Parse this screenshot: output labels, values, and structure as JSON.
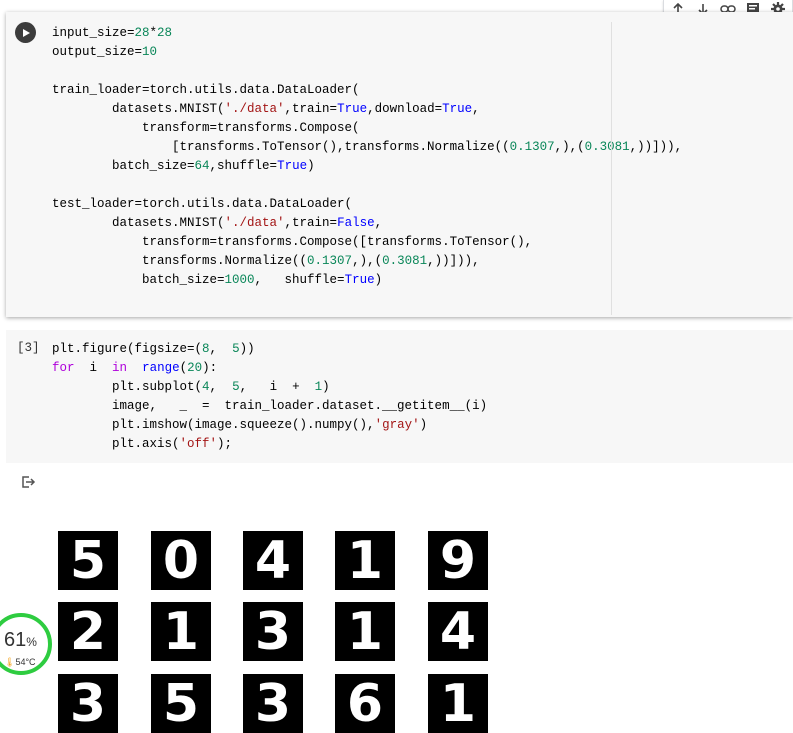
{
  "toolbar": {
    "icons": [
      "arrow-up-icon",
      "arrow-down-icon",
      "link-icon",
      "comment-icon",
      "settings-icon"
    ]
  },
  "cell1": {
    "lines": [
      [
        [
          "input_size=",
          ""
        ],
        [
          "28",
          "n"
        ],
        [
          "*",
          ""
        ],
        [
          "28",
          "n"
        ]
      ],
      [
        [
          "output_size=",
          ""
        ],
        [
          "10",
          "n"
        ]
      ],
      [],
      [
        [
          "train_loader=torch.utils.data.DataLoader(",
          ""
        ]
      ],
      [
        [
          "        datasets.MNIST(",
          ""
        ],
        [
          "'./data'",
          "s"
        ],
        [
          ",train=",
          ""
        ],
        [
          "True",
          "k"
        ],
        [
          ",download=",
          ""
        ],
        [
          "True",
          "k"
        ],
        [
          ",",
          ""
        ]
      ],
      [
        [
          "            transform=transforms.Compose(",
          ""
        ]
      ],
      [
        [
          "                [transforms.ToTensor(),transforms.Normalize((",
          ""
        ],
        [
          "0.1307",
          "n"
        ],
        [
          ",),(",
          ""
        ],
        [
          "0.3081",
          "n"
        ],
        [
          ",))])),",
          ""
        ]
      ],
      [
        [
          "        batch_size=",
          ""
        ],
        [
          "64",
          "n"
        ],
        [
          ",shuffle=",
          ""
        ],
        [
          "True",
          "k"
        ],
        [
          ")",
          ""
        ]
      ],
      [],
      [
        [
          "test_loader=torch.utils.data.DataLoader(",
          ""
        ]
      ],
      [
        [
          "        datasets.MNIST(",
          ""
        ],
        [
          "'./data'",
          "s"
        ],
        [
          ",train=",
          ""
        ],
        [
          "False",
          "k"
        ],
        [
          ",",
          ""
        ]
      ],
      [
        [
          "            transform=transforms.Compose([transforms.ToTensor(),",
          ""
        ]
      ],
      [
        [
          "            transforms.Normalize((",
          ""
        ],
        [
          "0.1307",
          "n"
        ],
        [
          ",),(",
          ""
        ],
        [
          "0.3081",
          "n"
        ],
        [
          ",))])),",
          ""
        ]
      ],
      [
        [
          "            batch_size=",
          ""
        ],
        [
          "1000",
          "n"
        ],
        [
          ",   shuffle=",
          ""
        ],
        [
          "True",
          "k"
        ],
        [
          ")",
          ""
        ]
      ]
    ]
  },
  "cell2": {
    "exec_count": "[3]",
    "lines": [
      [
        [
          "plt.figure(figsize=(",
          ""
        ],
        [
          "8",
          "n"
        ],
        [
          ",  ",
          ""
        ],
        [
          "5",
          "n"
        ],
        [
          "))",
          ""
        ]
      ],
      [
        [
          "for",
          "kw"
        ],
        [
          "  i  ",
          ""
        ],
        [
          "in",
          "kw"
        ],
        [
          "  ",
          ""
        ],
        [
          "range",
          "k"
        ],
        [
          "(",
          ""
        ],
        [
          "20",
          "n"
        ],
        [
          "):",
          ""
        ]
      ],
      [
        [
          "        plt.subplot(",
          ""
        ],
        [
          "4",
          "n"
        ],
        [
          ",  ",
          ""
        ],
        [
          "5",
          "n"
        ],
        [
          ",   i  +  ",
          ""
        ],
        [
          "1",
          "n"
        ],
        [
          ")",
          ""
        ]
      ],
      [
        [
          "        image,   _  =  train_loader.dataset.__getitem__(i)",
          ""
        ]
      ],
      [
        [
          "        plt.imshow(image.squeeze().numpy(),",
          ""
        ],
        [
          "'gray'",
          "s"
        ],
        [
          ")",
          ""
        ]
      ],
      [
        [
          "        plt.axis(",
          ""
        ],
        [
          "'off'",
          "s"
        ],
        [
          ");",
          ""
        ]
      ]
    ]
  },
  "output": {
    "icon": "output-redirect-icon",
    "digits": [
      [
        "5",
        "0",
        "4",
        "1",
        "9"
      ],
      [
        "2",
        "1",
        "3",
        "1",
        "4"
      ],
      [
        "3",
        "5",
        "3",
        "6",
        "1"
      ]
    ]
  },
  "widget": {
    "percent": "61",
    "percent_sign": "%",
    "temperature": "54°C",
    "ring_color": "#2ecc40"
  }
}
